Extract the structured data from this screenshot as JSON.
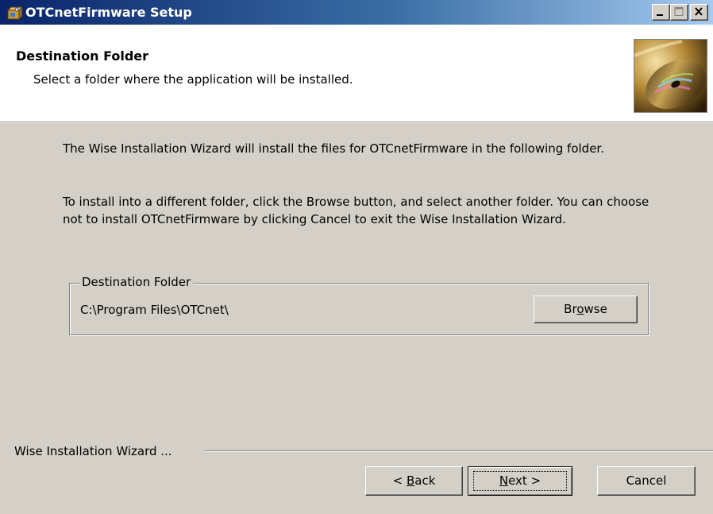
{
  "window": {
    "title": "OTCnetFirmware Setup",
    "controls": {
      "minimize": "_",
      "maximize": "□",
      "close": "X"
    }
  },
  "header": {
    "title": "Destination Folder",
    "subtitle": "Select a folder where the application will be installed."
  },
  "body": {
    "paragraph1": "The Wise Installation Wizard will install the files for OTCnetFirmware in the following folder.",
    "paragraph2": "To install into a different folder, click the Browse button, and select another folder. You can choose not to install OTCnetFirmware by clicking Cancel to exit the Wise Installation Wizard."
  },
  "destination": {
    "group_label": "Destination Folder",
    "path": "C:\\Program Files\\OTCnet\\",
    "browse": {
      "pre": "Br",
      "accel": "o",
      "post": "wse"
    }
  },
  "footer": {
    "label": "Wise Installation Wizard ...",
    "back": {
      "pre": "< ",
      "accel": "B",
      "post": "ack"
    },
    "next": {
      "pre": "",
      "accel": "N",
      "post": "ext >"
    },
    "cancel": "Cancel"
  },
  "colors": {
    "titlebar_start": "#0a246a",
    "titlebar_end": "#a6caf0",
    "dialog_bg": "#d4d0c8",
    "header_bg": "#ffffff"
  },
  "icons": {
    "app": "setup-box-icon",
    "header_art": "cd-disc-art"
  }
}
